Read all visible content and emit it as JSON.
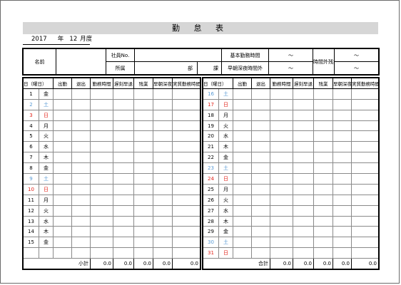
{
  "title": "勤 怠 表",
  "period": {
    "year": "2017",
    "year_suffix": "年",
    "month": "12",
    "month_suffix": "月度"
  },
  "info": {
    "name_label": "名前",
    "employee_no_label": "社員No.",
    "dept_label": "所属",
    "dept_unit": "部",
    "section_unit": "課",
    "basic_hours_label": "基本勤務時間",
    "basic_hours_value": "～",
    "early_late_label": "早朝深夜時間外",
    "early_late_value": "～",
    "overtime_label": "時間外残業",
    "overtime_value_1": "～",
    "overtime_value_2": "～"
  },
  "columns": {
    "day": "日（曜日）",
    "in": "出勤",
    "out": "退出",
    "work_hours": "勤務時間",
    "late_early": "遅刻早退",
    "overtime": "残業",
    "early_late_night": "早朝深夜",
    "actual_hours": "実質勤務時間"
  },
  "left_rows": [
    {
      "d": "1",
      "w": "金",
      "t": "n"
    },
    {
      "d": "2",
      "w": "土",
      "t": "sat"
    },
    {
      "d": "3",
      "w": "日",
      "t": "sun"
    },
    {
      "d": "4",
      "w": "月",
      "t": "n"
    },
    {
      "d": "5",
      "w": "火",
      "t": "n"
    },
    {
      "d": "6",
      "w": "水",
      "t": "n"
    },
    {
      "d": "7",
      "w": "木",
      "t": "n"
    },
    {
      "d": "8",
      "w": "金",
      "t": "n"
    },
    {
      "d": "9",
      "w": "土",
      "t": "sat"
    },
    {
      "d": "10",
      "w": "日",
      "t": "sun"
    },
    {
      "d": "11",
      "w": "月",
      "t": "n"
    },
    {
      "d": "12",
      "w": "火",
      "t": "n"
    },
    {
      "d": "13",
      "w": "水",
      "t": "n"
    },
    {
      "d": "14",
      "w": "木",
      "t": "n"
    },
    {
      "d": "15",
      "w": "金",
      "t": "n"
    }
  ],
  "right_rows": [
    {
      "d": "16",
      "w": "土",
      "t": "sat"
    },
    {
      "d": "17",
      "w": "日",
      "t": "sun"
    },
    {
      "d": "18",
      "w": "月",
      "t": "n"
    },
    {
      "d": "19",
      "w": "火",
      "t": "n"
    },
    {
      "d": "20",
      "w": "水",
      "t": "n"
    },
    {
      "d": "21",
      "w": "木",
      "t": "n"
    },
    {
      "d": "22",
      "w": "金",
      "t": "n"
    },
    {
      "d": "23",
      "w": "土",
      "t": "sat"
    },
    {
      "d": "24",
      "w": "日",
      "t": "sun"
    },
    {
      "d": "25",
      "w": "月",
      "t": "n"
    },
    {
      "d": "26",
      "w": "火",
      "t": "n"
    },
    {
      "d": "27",
      "w": "水",
      "t": "n"
    },
    {
      "d": "28",
      "w": "木",
      "t": "n"
    },
    {
      "d": "29",
      "w": "金",
      "t": "n"
    },
    {
      "d": "30",
      "w": "土",
      "t": "sat"
    },
    {
      "d": "31",
      "w": "日",
      "t": "sun"
    }
  ],
  "left_totals": {
    "label": "小計",
    "values": [
      "0.0",
      "0.0",
      "0.0",
      "0.0",
      "0.0"
    ]
  },
  "right_totals": {
    "label": "合計",
    "values": [
      "0.0",
      "0.0",
      "0.0",
      "0.0",
      "0.0"
    ]
  },
  "colors": {
    "saturday": "#5b9bd5",
    "sunday": "#e2231a",
    "title_bg": "#d6d6d6"
  }
}
